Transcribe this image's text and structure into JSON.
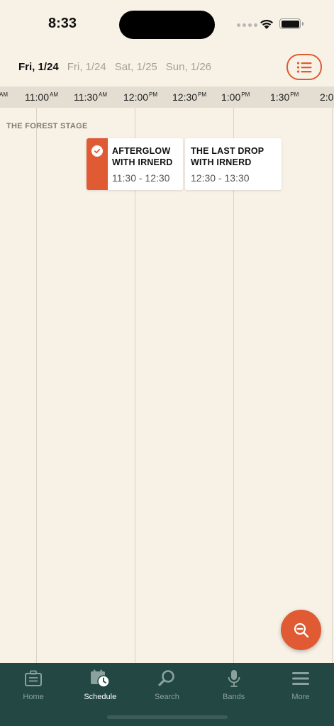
{
  "status_bar": {
    "time": "8:33"
  },
  "dates": {
    "selected": "Fri, 1/24",
    "tabs": [
      "Fri, 1/24",
      "Sat, 1/25",
      "Sun, 1/26"
    ]
  },
  "timeline": {
    "ticks": [
      {
        "time": "",
        "suffix": "AM"
      },
      {
        "time": "11:00",
        "suffix": "AM"
      },
      {
        "time": "11:30",
        "suffix": "AM"
      },
      {
        "time": "12:00",
        "suffix": "PM"
      },
      {
        "time": "12:30",
        "suffix": "PM"
      },
      {
        "time": "1:00",
        "suffix": "PM"
      },
      {
        "time": "1:30",
        "suffix": "PM"
      },
      {
        "time": "2:0",
        "suffix": ""
      }
    ]
  },
  "stage": {
    "name": "THE FOREST STAGE"
  },
  "events": [
    {
      "title": "AFTERGLOW WITH IRNERD",
      "time": "11:30 - 12:30",
      "favorited": true
    },
    {
      "title": "THE LAST DROP WITH IRNERD",
      "time": "12:30 - 13:30",
      "favorited": false
    }
  ],
  "tabs": [
    {
      "label": "Home",
      "icon": "home-icon",
      "active": false
    },
    {
      "label": "Schedule",
      "icon": "schedule-icon",
      "active": true
    },
    {
      "label": "Search",
      "icon": "search-icon",
      "active": false
    },
    {
      "label": "Bands",
      "icon": "microphone-icon",
      "active": false
    },
    {
      "label": "More",
      "icon": "menu-icon",
      "active": false
    }
  ],
  "colors": {
    "accent": "#e05a33",
    "background": "#f7f1e6",
    "tab_bar": "#234743"
  }
}
